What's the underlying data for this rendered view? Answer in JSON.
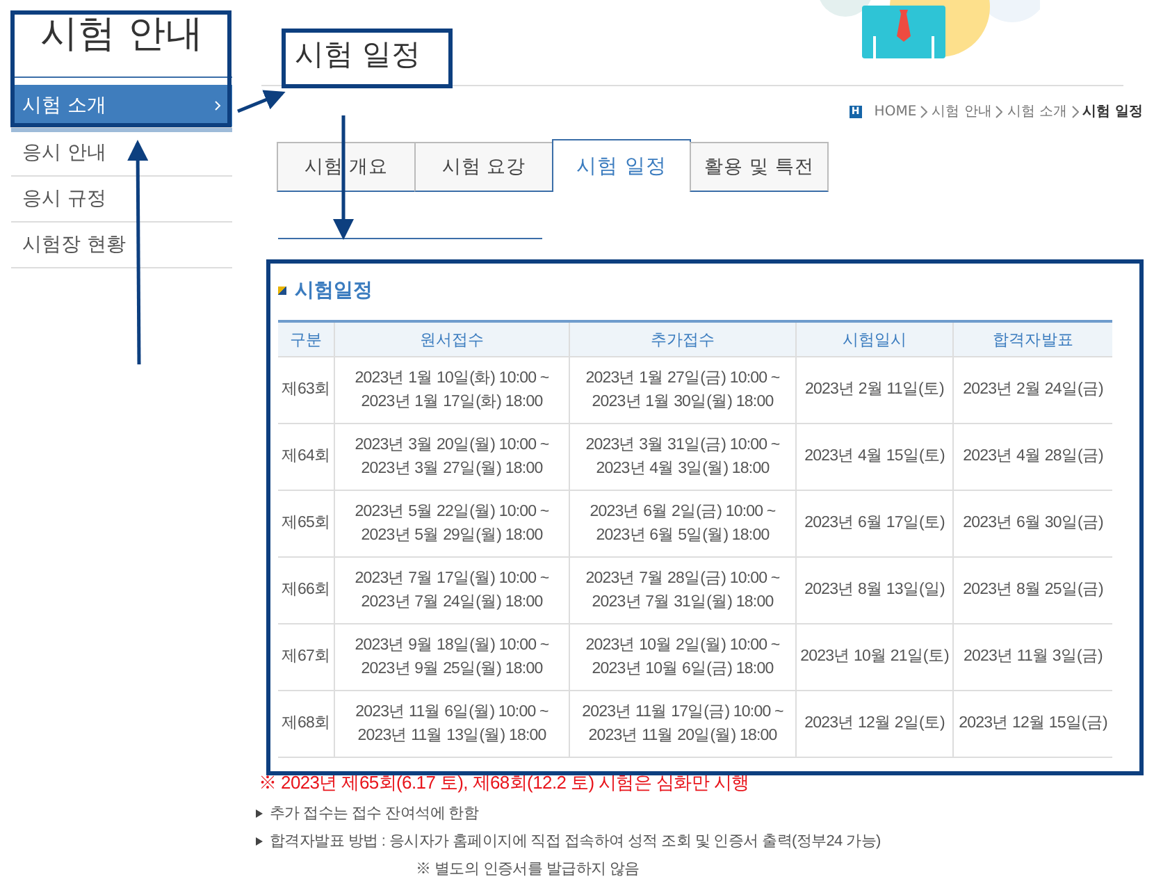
{
  "sidebar": {
    "title": "시험 안내",
    "items": [
      {
        "label": "시험 소개",
        "selected": true
      },
      {
        "label": "응시 안내",
        "selected": false
      },
      {
        "label": "응시 규정",
        "selected": false
      },
      {
        "label": "시험장 현황",
        "selected": false
      }
    ]
  },
  "page_title": "시험 일정",
  "breadcrumb": {
    "icon_text": "H",
    "items": [
      "HOME",
      "시험 안내",
      "시험 소개",
      "시험 일정"
    ]
  },
  "tabs": [
    {
      "label": "시험 개요",
      "selected": false
    },
    {
      "label": "시험 요강",
      "selected": false
    },
    {
      "label": "시험 일정",
      "selected": true
    },
    {
      "label": "활용 및 특전",
      "selected": false
    }
  ],
  "section_title": "시험일정",
  "table": {
    "columns": [
      "구분",
      "원서접수",
      "추가접수",
      "시험일시",
      "합격자발표"
    ],
    "rows": [
      {
        "round": "제63회",
        "application": [
          "2023년 1월 10일(화) 10:00 ~",
          "2023년 1월 17일(화) 18:00"
        ],
        "additional": [
          "2023년 1월 27일(금) 10:00 ~",
          "2023년 1월 30일(월) 18:00"
        ],
        "exam_date": "2023년 2월 11일(토)",
        "result_date": "2023년 2월 24일(금)"
      },
      {
        "round": "제64회",
        "application": [
          "2023년 3월 20일(월) 10:00 ~",
          "2023년 3월 27일(월) 18:00"
        ],
        "additional": [
          "2023년 3월 31일(금) 10:00 ~",
          "2023년 4월 3일(월) 18:00"
        ],
        "exam_date": "2023년 4월 15일(토)",
        "result_date": "2023년 4월 28일(금)"
      },
      {
        "round": "제65회",
        "application": [
          "2023년 5월 22일(월) 10:00 ~",
          "2023년 5월 29일(월) 18:00"
        ],
        "additional": [
          "2023년 6월 2일(금) 10:00 ~",
          "2023년 6월 5일(월) 18:00"
        ],
        "exam_date": "2023년 6월 17일(토)",
        "result_date": "2023년 6월 30일(금)"
      },
      {
        "round": "제66회",
        "application": [
          "2023년 7월 17일(월) 10:00 ~",
          "2023년 7월 24일(월) 18:00"
        ],
        "additional": [
          "2023년 7월 28일(금) 10:00 ~",
          "2023년 7월 31일(월) 18:00"
        ],
        "exam_date": "2023년 8월 13일(일)",
        "result_date": "2023년 8월 25일(금)"
      },
      {
        "round": "제67회",
        "application": [
          "2023년 9월 18일(월) 10:00 ~",
          "2023년 9월 25일(월) 18:00"
        ],
        "additional": [
          "2023년 10월 2일(월) 10:00 ~",
          "2023년 10월 6일(금) 18:00"
        ],
        "exam_date": "2023년 10월 21일(토)",
        "result_date": "2023년 11월 3일(금)"
      },
      {
        "round": "제68회",
        "application": [
          "2023년 11월 6일(월) 10:00 ~",
          "2023년 11월 13일(월) 18:00"
        ],
        "additional": [
          "2023년 11월 17일(금) 10:00 ~",
          "2023년 11월 20일(월) 18:00"
        ],
        "exam_date": "2023년 12월 2일(토)",
        "result_date": "2023년 12월 15일(금)"
      }
    ]
  },
  "notes": [
    {
      "kind": "warning",
      "text": "※ 2023년 제65회(6.17 토), 제68회(12.2 토) 시험은 심화만 시행"
    },
    {
      "kind": "bullet",
      "text": "추가 접수는 접수 잔여석에 한함"
    },
    {
      "kind": "bullet",
      "text": "합격자발표 방법 : 응시자가 홈페이지에 직접 접속하여 성적 조회 및 인증서 출력(정부24 가능)"
    },
    {
      "kind": "sub",
      "text": "※ 별도의 인증서를 발급하지 않음"
    }
  ]
}
